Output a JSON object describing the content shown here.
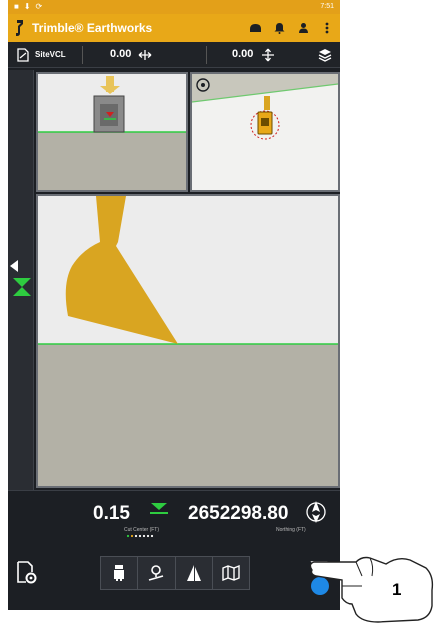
{
  "status_bar": {
    "time": "7:51"
  },
  "header": {
    "app_title": "Trimble® Earthworks"
  },
  "info_bar": {
    "design_name": "SiteVCL",
    "horizontal_offset": "0.00",
    "vertical_offset": "0.00"
  },
  "bottom_info": {
    "cut_fill_value": "0.15",
    "cut_fill_label": "Cut Center (FT)",
    "northing_value": "2652298.80",
    "northing_label": "Northing (FT)"
  },
  "callout": {
    "number": "1"
  },
  "colors": {
    "brand_yellow": "#e8a818",
    "on_grade_green": "#2ecc40",
    "bucket_gold": "#d9a521",
    "ground": "#b3b1a6",
    "accent_blue": "#1e88e5"
  },
  "icons": {
    "header": [
      "machine-icon",
      "bell-icon",
      "person-icon",
      "more-vert-icon"
    ],
    "views": [
      "profile-view-icon",
      "plan-view-icon",
      "cross-section-view-icon",
      "map-view-icon"
    ]
  }
}
